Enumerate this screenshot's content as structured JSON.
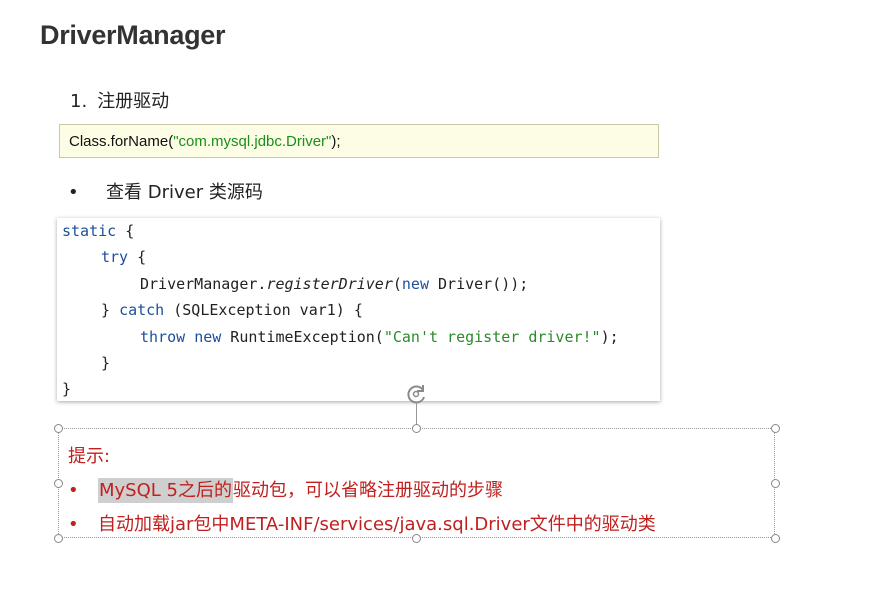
{
  "page": {
    "title": "DriverManager",
    "step": {
      "number": "1.",
      "label": "注册驱动"
    },
    "code_inline": {
      "prefix": "Class.forName",
      "open": "(",
      "string": "\"com.mysql.jdbc.Driver\"",
      "close": ");"
    },
    "bullet": {
      "dot": "•",
      "text": "查看 Driver 类源码"
    },
    "code_block": {
      "l1_kw": "static",
      "l1_rest": " {",
      "l2_kw": "try",
      "l2_rest": " {",
      "l3_a": "DriverManager.",
      "l3_fn": "registerDriver",
      "l3_b": "(",
      "l3_kw": "new",
      "l3_c": " Driver());",
      "l4_a": "} ",
      "l4_kw": "catch",
      "l4_b": " (SQLException var1) {",
      "l5_kw1": "throw",
      "l5_sp": " ",
      "l5_kw2": "new",
      "l5_a": " RuntimeException(",
      "l5_str": "\"Can't register driver!\"",
      "l5_b": ");",
      "l6": "}",
      "l7": "}"
    },
    "hint": {
      "title": "提示:",
      "items": [
        {
          "dot": "•",
          "highlight": "MySQL 5之后的",
          "rest": "驱动包，可以省略注册驱动的步骤"
        },
        {
          "dot": "•",
          "text": "自动加载jar包中META-INF/services/java.sql.Driver文件中的驱动类"
        }
      ]
    }
  },
  "colors": {
    "hint_red": "#c0201e",
    "keyword_blue": "#1c4f9c",
    "string_green": "#2a8b2a",
    "inline_bg": "#fdfde6"
  },
  "icons": {
    "rotate": "rotate-handle-icon"
  }
}
